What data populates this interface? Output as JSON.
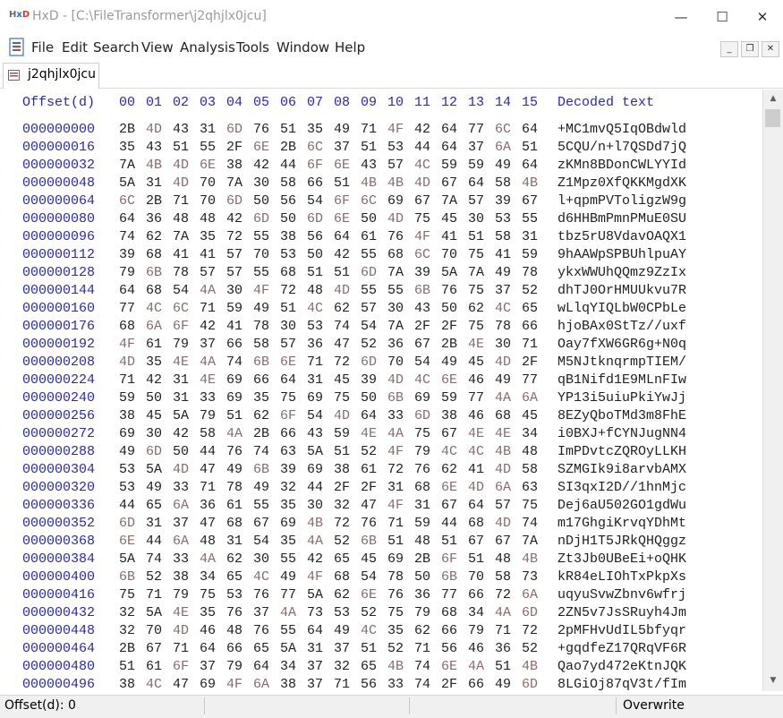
{
  "window": {
    "app_name": "HxD",
    "title": "HxD - [C:\\FileTransformer\\j2qhjlx0jcu]",
    "controls": {
      "minimize": "—",
      "maximize": "☐",
      "close": "✕"
    }
  },
  "menu": [
    "File",
    "Edit",
    "Search",
    "View",
    "Analysis",
    "Tools",
    "Window",
    "Help"
  ],
  "mdi_controls": {
    "minimize": "_",
    "restore": "❐",
    "close": "✕"
  },
  "tab": {
    "label": "j2qhjlx0jcu"
  },
  "hex_header": {
    "offset_label": "Offset(d)",
    "columns": [
      "00",
      "01",
      "02",
      "03",
      "04",
      "05",
      "06",
      "07",
      "08",
      "09",
      "10",
      "11",
      "12",
      "13",
      "14",
      "15"
    ],
    "decoded_label": "Decoded text"
  },
  "rows": [
    {
      "offset": "000000000",
      "bytes": [
        "2B",
        "4D",
        "43",
        "31",
        "6D",
        "76",
        "51",
        "35",
        "49",
        "71",
        "4F",
        "42",
        "64",
        "77",
        "6C",
        "64"
      ],
      "decoded": "+MC1mvQ5IqOBdwld"
    },
    {
      "offset": "000000016",
      "bytes": [
        "35",
        "43",
        "51",
        "55",
        "2F",
        "6E",
        "2B",
        "6C",
        "37",
        "51",
        "53",
        "44",
        "64",
        "37",
        "6A",
        "51"
      ],
      "decoded": "5CQU/n+l7QSDd7jQ"
    },
    {
      "offset": "000000032",
      "bytes": [
        "7A",
        "4B",
        "4D",
        "6E",
        "38",
        "42",
        "44",
        "6F",
        "6E",
        "43",
        "57",
        "4C",
        "59",
        "59",
        "49",
        "64"
      ],
      "decoded": "zKMn8BDonCWLYYId"
    },
    {
      "offset": "000000048",
      "bytes": [
        "5A",
        "31",
        "4D",
        "70",
        "7A",
        "30",
        "58",
        "66",
        "51",
        "4B",
        "4B",
        "4D",
        "67",
        "64",
        "58",
        "4B"
      ],
      "decoded": "Z1Mpz0XfQKKMgdXK"
    },
    {
      "offset": "000000064",
      "bytes": [
        "6C",
        "2B",
        "71",
        "70",
        "6D",
        "50",
        "56",
        "54",
        "6F",
        "6C",
        "69",
        "67",
        "7A",
        "57",
        "39",
        "67"
      ],
      "decoded": "l+qpmPVToligzW9g"
    },
    {
      "offset": "000000080",
      "bytes": [
        "64",
        "36",
        "48",
        "48",
        "42",
        "6D",
        "50",
        "6D",
        "6E",
        "50",
        "4D",
        "75",
        "45",
        "30",
        "53",
        "55"
      ],
      "decoded": "d6HHBmPmnPMuE0SU"
    },
    {
      "offset": "000000096",
      "bytes": [
        "74",
        "62",
        "7A",
        "35",
        "72",
        "55",
        "38",
        "56",
        "64",
        "61",
        "76",
        "4F",
        "41",
        "51",
        "58",
        "31"
      ],
      "decoded": "tbz5rU8VdavOAQX1"
    },
    {
      "offset": "000000112",
      "bytes": [
        "39",
        "68",
        "41",
        "41",
        "57",
        "70",
        "53",
        "50",
        "42",
        "55",
        "68",
        "6C",
        "70",
        "75",
        "41",
        "59"
      ],
      "decoded": "9hAAWpSPBUhlpuAY"
    },
    {
      "offset": "000000128",
      "bytes": [
        "79",
        "6B",
        "78",
        "57",
        "57",
        "55",
        "68",
        "51",
        "51",
        "6D",
        "7A",
        "39",
        "5A",
        "7A",
        "49",
        "78"
      ],
      "decoded": "ykxWWUhQQmz9ZzIx"
    },
    {
      "offset": "000000144",
      "bytes": [
        "64",
        "68",
        "54",
        "4A",
        "30",
        "4F",
        "72",
        "48",
        "4D",
        "55",
        "55",
        "6B",
        "76",
        "75",
        "37",
        "52"
      ],
      "decoded": "dhTJ0OrHMUUkvu7R"
    },
    {
      "offset": "000000160",
      "bytes": [
        "77",
        "4C",
        "6C",
        "71",
        "59",
        "49",
        "51",
        "4C",
        "62",
        "57",
        "30",
        "43",
        "50",
        "62",
        "4C",
        "65"
      ],
      "decoded": "wLlqYIQLbW0CPbLe"
    },
    {
      "offset": "000000176",
      "bytes": [
        "68",
        "6A",
        "6F",
        "42",
        "41",
        "78",
        "30",
        "53",
        "74",
        "54",
        "7A",
        "2F",
        "2F",
        "75",
        "78",
        "66"
      ],
      "decoded": "hjoBAx0StTz//uxf"
    },
    {
      "offset": "000000192",
      "bytes": [
        "4F",
        "61",
        "79",
        "37",
        "66",
        "58",
        "57",
        "36",
        "47",
        "52",
        "36",
        "67",
        "2B",
        "4E",
        "30",
        "71"
      ],
      "decoded": "Oay7fXW6GR6g+N0q"
    },
    {
      "offset": "000000208",
      "bytes": [
        "4D",
        "35",
        "4E",
        "4A",
        "74",
        "6B",
        "6E",
        "71",
        "72",
        "6D",
        "70",
        "54",
        "49",
        "45",
        "4D",
        "2F"
      ],
      "decoded": "M5NJtknqrmpTIEM/"
    },
    {
      "offset": "000000224",
      "bytes": [
        "71",
        "42",
        "31",
        "4E",
        "69",
        "66",
        "64",
        "31",
        "45",
        "39",
        "4D",
        "4C",
        "6E",
        "46",
        "49",
        "77"
      ],
      "decoded": "qB1Nifd1E9MLnFIw"
    },
    {
      "offset": "000000240",
      "bytes": [
        "59",
        "50",
        "31",
        "33",
        "69",
        "35",
        "75",
        "69",
        "75",
        "50",
        "6B",
        "69",
        "59",
        "77",
        "4A",
        "6A"
      ],
      "decoded": "YP13i5uiuPkiYwJj"
    },
    {
      "offset": "000000256",
      "bytes": [
        "38",
        "45",
        "5A",
        "79",
        "51",
        "62",
        "6F",
        "54",
        "4D",
        "64",
        "33",
        "6D",
        "38",
        "46",
        "68",
        "45"
      ],
      "decoded": "8EZyQboTMd3m8FhE"
    },
    {
      "offset": "000000272",
      "bytes": [
        "69",
        "30",
        "42",
        "58",
        "4A",
        "2B",
        "66",
        "43",
        "59",
        "4E",
        "4A",
        "75",
        "67",
        "4E",
        "4E",
        "34"
      ],
      "decoded": "i0BXJ+fCYNJugNN4"
    },
    {
      "offset": "000000288",
      "bytes": [
        "49",
        "6D",
        "50",
        "44",
        "76",
        "74",
        "63",
        "5A",
        "51",
        "52",
        "4F",
        "79",
        "4C",
        "4C",
        "4B",
        "48"
      ],
      "decoded": "ImPDvtcZQROyLLKH"
    },
    {
      "offset": "000000304",
      "bytes": [
        "53",
        "5A",
        "4D",
        "47",
        "49",
        "6B",
        "39",
        "69",
        "38",
        "61",
        "72",
        "76",
        "62",
        "41",
        "4D",
        "58"
      ],
      "decoded": "SZMGIk9i8arvbAMX"
    },
    {
      "offset": "000000320",
      "bytes": [
        "53",
        "49",
        "33",
        "71",
        "78",
        "49",
        "32",
        "44",
        "2F",
        "2F",
        "31",
        "68",
        "6E",
        "4D",
        "6A",
        "63"
      ],
      "decoded": "SI3qxI2D//1hnMjc"
    },
    {
      "offset": "000000336",
      "bytes": [
        "44",
        "65",
        "6A",
        "36",
        "61",
        "55",
        "35",
        "30",
        "32",
        "47",
        "4F",
        "31",
        "67",
        "64",
        "57",
        "75"
      ],
      "decoded": "Dej6aU502GO1gdWu"
    },
    {
      "offset": "000000352",
      "bytes": [
        "6D",
        "31",
        "37",
        "47",
        "68",
        "67",
        "69",
        "4B",
        "72",
        "76",
        "71",
        "59",
        "44",
        "68",
        "4D",
        "74"
      ],
      "decoded": "m17GhgiKrvqYDhMt"
    },
    {
      "offset": "000000368",
      "bytes": [
        "6E",
        "44",
        "6A",
        "48",
        "31",
        "54",
        "35",
        "4A",
        "52",
        "6B",
        "51",
        "48",
        "51",
        "67",
        "67",
        "7A"
      ],
      "decoded": "nDjH1T5JRkQHQggz"
    },
    {
      "offset": "000000384",
      "bytes": [
        "5A",
        "74",
        "33",
        "4A",
        "62",
        "30",
        "55",
        "42",
        "65",
        "45",
        "69",
        "2B",
        "6F",
        "51",
        "48",
        "4B"
      ],
      "decoded": "Zt3Jb0UBeEi+oQHK"
    },
    {
      "offset": "000000400",
      "bytes": [
        "6B",
        "52",
        "38",
        "34",
        "65",
        "4C",
        "49",
        "4F",
        "68",
        "54",
        "78",
        "50",
        "6B",
        "70",
        "58",
        "73"
      ],
      "decoded": "kR84eLIOhTxPkpXs"
    },
    {
      "offset": "000000416",
      "bytes": [
        "75",
        "71",
        "79",
        "75",
        "53",
        "76",
        "77",
        "5A",
        "62",
        "6E",
        "76",
        "36",
        "77",
        "66",
        "72",
        "6A"
      ],
      "decoded": "uqyuSvwZbnv6wfrj"
    },
    {
      "offset": "000000432",
      "bytes": [
        "32",
        "5A",
        "4E",
        "35",
        "76",
        "37",
        "4A",
        "73",
        "53",
        "52",
        "75",
        "79",
        "68",
        "34",
        "4A",
        "6D"
      ],
      "decoded": "2ZN5v7JsSRuyh4Jm"
    },
    {
      "offset": "000000448",
      "bytes": [
        "32",
        "70",
        "4D",
        "46",
        "48",
        "76",
        "55",
        "64",
        "49",
        "4C",
        "35",
        "62",
        "66",
        "79",
        "71",
        "72"
      ],
      "decoded": "2pMFHvUdIL5bfyqr"
    },
    {
      "offset": "000000464",
      "bytes": [
        "2B",
        "67",
        "71",
        "64",
        "66",
        "65",
        "5A",
        "31",
        "37",
        "51",
        "52",
        "71",
        "56",
        "46",
        "36",
        "52"
      ],
      "decoded": "+gqdfeZ17QRqVF6R"
    },
    {
      "offset": "000000480",
      "bytes": [
        "51",
        "61",
        "6F",
        "37",
        "79",
        "64",
        "34",
        "37",
        "32",
        "65",
        "4B",
        "74",
        "6E",
        "4A",
        "51",
        "4B"
      ],
      "decoded": "Qao7yd472eKtnJQK"
    },
    {
      "offset": "000000496",
      "bytes": [
        "38",
        "4C",
        "47",
        "69",
        "4F",
        "6A",
        "38",
        "37",
        "71",
        "56",
        "33",
        "74",
        "2F",
        "66",
        "49",
        "6D"
      ],
      "decoded": "8LGiOj87qV3t/fIm"
    }
  ],
  "scrollbar": {
    "up": "▲",
    "down": "▼"
  },
  "status": {
    "offset": "Offset(d): 0",
    "mode": "Overwrite"
  },
  "colors": {
    "header_blue": "#2b2ba6",
    "byte_dark": "#222222",
    "byte_light": "#8b6b6b"
  }
}
